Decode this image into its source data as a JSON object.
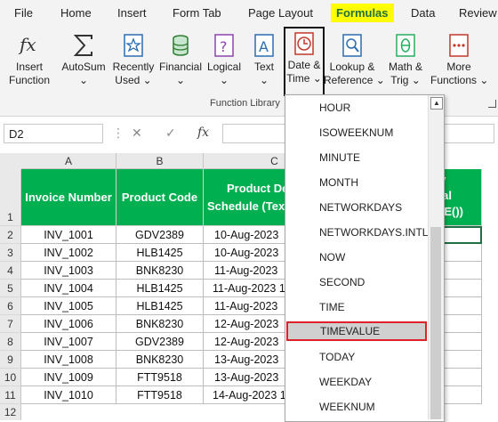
{
  "menu": [
    {
      "label": "File"
    },
    {
      "label": "Home"
    },
    {
      "label": "Insert"
    },
    {
      "label": "Form Tab"
    },
    {
      "label": "Page Layout"
    },
    {
      "label": "Formulas",
      "active": true
    },
    {
      "label": "Data"
    },
    {
      "label": "Review"
    }
  ],
  "ribbon": {
    "buttons": [
      {
        "line1": "Insert",
        "line2": "Function",
        "icon": "fx-icon"
      },
      {
        "line1": "AutoSum",
        "line2": "⌄",
        "icon": "sigma-icon"
      },
      {
        "line1": "Recently",
        "line2": "Used ⌄",
        "icon": "star-icon"
      },
      {
        "line1": "Financial",
        "line2": "⌄",
        "icon": "database-icon"
      },
      {
        "line1": "Logical",
        "line2": "⌄",
        "icon": "question-icon"
      },
      {
        "line1": "Text",
        "line2": "⌄",
        "icon": "text-a-icon"
      },
      {
        "line1": "Date &",
        "line2": "Time ⌄",
        "icon": "clock-icon",
        "selected": true
      },
      {
        "line1": "Lookup &",
        "line2": "Reference ⌄",
        "icon": "magnifier-icon"
      },
      {
        "line1": "Math &",
        "line2": "Trig ⌄",
        "icon": "theta-icon"
      },
      {
        "line1": "More",
        "line2": "Functions ⌄",
        "icon": "more-icon"
      }
    ],
    "group_label": "Function Library"
  },
  "formula_bar": {
    "name_box": "D2",
    "cancel_glyph": "✕",
    "enter_glyph": "✓",
    "fx_glyph": "fx",
    "value": ""
  },
  "sheet": {
    "columns": [
      "A",
      "B",
      "C"
    ],
    "headers": {
      "a": "Invoice Number",
      "b": "Product Code",
      "c_line1": "Product De",
      "c_line2": "Schedule (Tex",
      "e_line1": "ery",
      "e_line2": "imal",
      "e_line3": "LUE())"
    },
    "rows": [
      {
        "num": "1"
      },
      {
        "num": "2",
        "invoice": "INV_1001",
        "code": "GDV2389",
        "date": "10-Aug-2023"
      },
      {
        "num": "3",
        "invoice": "INV_1002",
        "code": "HLB1425",
        "date": "10-Aug-2023"
      },
      {
        "num": "4",
        "invoice": "INV_1003",
        "code": "BNK8230",
        "date": "11-Aug-2023"
      },
      {
        "num": "5",
        "invoice": "INV_1004",
        "code": "HLB1425",
        "date": "11-Aug-2023 1"
      },
      {
        "num": "6",
        "invoice": "INV_1005",
        "code": "HLB1425",
        "date": "11-Aug-2023"
      },
      {
        "num": "7",
        "invoice": "INV_1006",
        "code": "BNK8230",
        "date": "12-Aug-2023"
      },
      {
        "num": "8",
        "invoice": "INV_1007",
        "code": "GDV2389",
        "date": "12-Aug-2023"
      },
      {
        "num": "9",
        "invoice": "INV_1008",
        "code": "BNK8230",
        "date": "13-Aug-2023"
      },
      {
        "num": "10",
        "invoice": "INV_1009",
        "code": "FTT9518",
        "date": "13-Aug-2023"
      },
      {
        "num": "11",
        "invoice": "INV_1010",
        "code": "FTT9518",
        "date": "14-Aug-2023 1"
      },
      {
        "num": "12"
      }
    ]
  },
  "dropdown": {
    "items": [
      {
        "label": "HOUR"
      },
      {
        "label": "ISOWEEKNUM"
      },
      {
        "label": "MINUTE"
      },
      {
        "label": "MONTH"
      },
      {
        "label": "NETWORKDAYS"
      },
      {
        "label": "NETWORKDAYS.INTL"
      },
      {
        "label": "NOW"
      },
      {
        "label": "SECOND"
      },
      {
        "label": "TIME"
      },
      {
        "label": "TIMEVALUE",
        "highlighted": true
      },
      {
        "label": "TODAY"
      },
      {
        "label": "WEEKDAY"
      },
      {
        "label": "WEEKNUM"
      }
    ],
    "scroll_up_glyph": "▲"
  },
  "colors": {
    "header_green": "#00b050",
    "formulas_tab_text": "#1f6e3e",
    "highlight_yellow": "#ffff00",
    "highlight_red": "#e0202a"
  }
}
